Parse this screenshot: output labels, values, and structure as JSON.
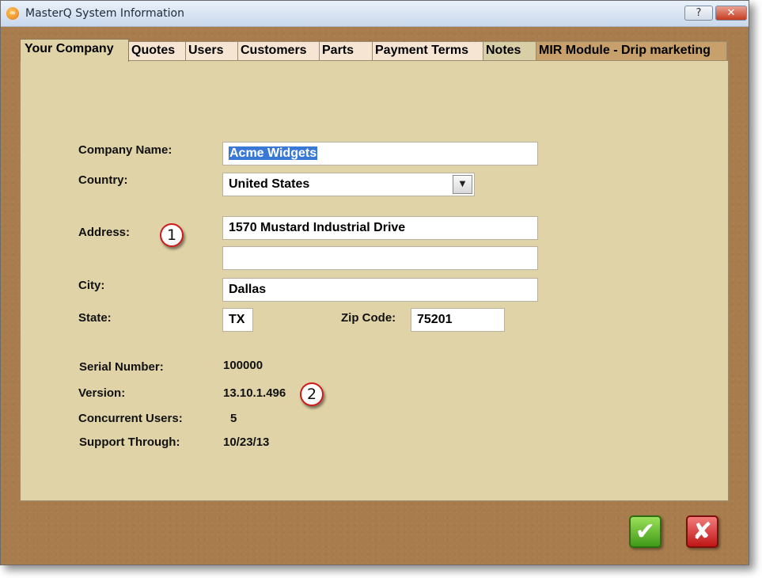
{
  "window": {
    "title": "MasterQ System Information",
    "app_icon_glyph": "∞",
    "help_glyph": "?",
    "close_glyph": "✕"
  },
  "tabs": [
    {
      "label": "Your Company",
      "active": true
    },
    {
      "label": "Quotes"
    },
    {
      "label": "Users"
    },
    {
      "label": "Customers"
    },
    {
      "label": "Parts"
    },
    {
      "label": "Payment Terms"
    },
    {
      "label": "Notes"
    },
    {
      "label": "MIR Module - Drip marketing"
    }
  ],
  "form": {
    "company_name_label": "Company Name:",
    "company_name_value": "Acme Widgets",
    "country_label": "Country:",
    "country_value": "United States",
    "address_label": "Address:",
    "address_line1": "1570 Mustard Industrial Drive",
    "address_line2": "",
    "city_label": "City:",
    "city_value": "Dallas",
    "state_label": "State:",
    "state_value": "TX",
    "zip_label": "Zip Code:",
    "zip_value": "75201"
  },
  "info": {
    "serial_label": "Serial Number:",
    "serial_value": "100000",
    "version_label": "Version:",
    "version_value": "13.10.1.496",
    "users_label": "Concurrent Users:",
    "users_value": "5",
    "support_label": "Support Through:",
    "support_value": "10/23/13"
  },
  "callouts": [
    "1",
    "2"
  ],
  "buttons": {
    "ok_glyph": "✔",
    "cancel_glyph": "✘"
  },
  "colors": {
    "panel_bg": "#e0d3a7",
    "frame_bg": "#a87c4c",
    "selection": "#3a78d6",
    "ok_green": "#3f9a18",
    "cancel_red": "#c01616",
    "callout_border": "#cc1a1a"
  }
}
